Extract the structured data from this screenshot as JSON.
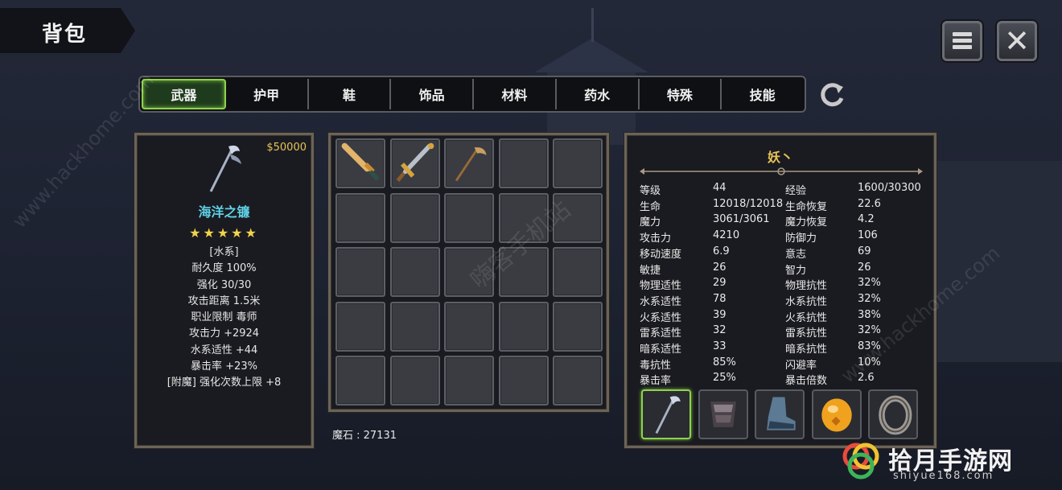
{
  "title": "背包",
  "tabs": [
    "武器",
    "护甲",
    "鞋",
    "饰品",
    "材料",
    "药水",
    "特殊",
    "技能"
  ],
  "active_tab": 0,
  "icons": {
    "menu": "menu-icon",
    "close": "close-icon",
    "refresh": "refresh-icon"
  },
  "item_detail": {
    "price": "$50000",
    "name": "海洋之镰",
    "stars": "★★★★★",
    "lines": [
      "[水系]",
      "耐久度 100%",
      "强化 30/30",
      "攻击距离  1.5米",
      "职业限制  毒师",
      "攻击力  +2924",
      "水系适性  +44",
      "暴击率  +23%",
      "[附魔] 强化次数上限 +8"
    ]
  },
  "inventory": {
    "slots": [
      {
        "icon": "wooden-sword-icon"
      },
      {
        "icon": "steel-sword-icon"
      },
      {
        "icon": "scythe-icon"
      },
      {},
      {},
      {},
      {},
      {},
      {},
      {},
      {},
      {},
      {},
      {},
      {},
      {},
      {},
      {},
      {},
      {},
      {},
      {},
      {},
      {},
      {}
    ],
    "mana_stone": "魔石 : 27131"
  },
  "character": {
    "name": "妖丶",
    "stats_left": [
      [
        "等级",
        "44"
      ],
      [
        "生命",
        "12018/12018"
      ],
      [
        "魔力",
        "3061/3061"
      ],
      [
        "攻击力",
        "4210"
      ],
      [
        "移动速度",
        "6.9"
      ],
      [
        "敏捷",
        "26"
      ],
      [
        "物理适性",
        "29"
      ],
      [
        "水系适性",
        "78"
      ],
      [
        "火系适性",
        "39"
      ],
      [
        "雷系适性",
        "32"
      ],
      [
        "暗系适性",
        "33"
      ],
      [
        "毒抗性",
        "85%"
      ],
      [
        "暴击率",
        "25%"
      ]
    ],
    "stats_right": [
      [
        "经验",
        "1600/30300"
      ],
      [
        "生命恢复",
        "22.6"
      ],
      [
        "魔力恢复",
        "4.2"
      ],
      [
        "防御力",
        "106"
      ],
      [
        "意志",
        "69"
      ],
      [
        "智力",
        "26"
      ],
      [
        "物理抗性",
        "32%"
      ],
      [
        "水系抗性",
        "32%"
      ],
      [
        "火系抗性",
        "38%"
      ],
      [
        "雷系抗性",
        "32%"
      ],
      [
        "暗系抗性",
        "83%"
      ],
      [
        "闪避率",
        "10%"
      ],
      [
        "暴击倍数",
        "2.6"
      ]
    ],
    "equipment": [
      {
        "icon": "scythe-weapon-icon",
        "active": true
      },
      {
        "icon": "chest-armor-icon",
        "active": false
      },
      {
        "icon": "boots-icon",
        "active": false
      },
      {
        "icon": "amber-gem-icon",
        "active": false
      },
      {
        "icon": "ring-icon",
        "active": false
      }
    ]
  },
  "watermarks": {
    "left": "www.hackhome.com",
    "center": "嗨客手机站",
    "right": "www.hackhome.com"
  },
  "site": {
    "name": "拾月手游网",
    "domain": "shiyue168.com"
  },
  "colors": {
    "accent_green": "#8fd14f",
    "gold": "#e8c35a",
    "item_name": "#5fd0e6",
    "panel_border": "#6b6358"
  }
}
